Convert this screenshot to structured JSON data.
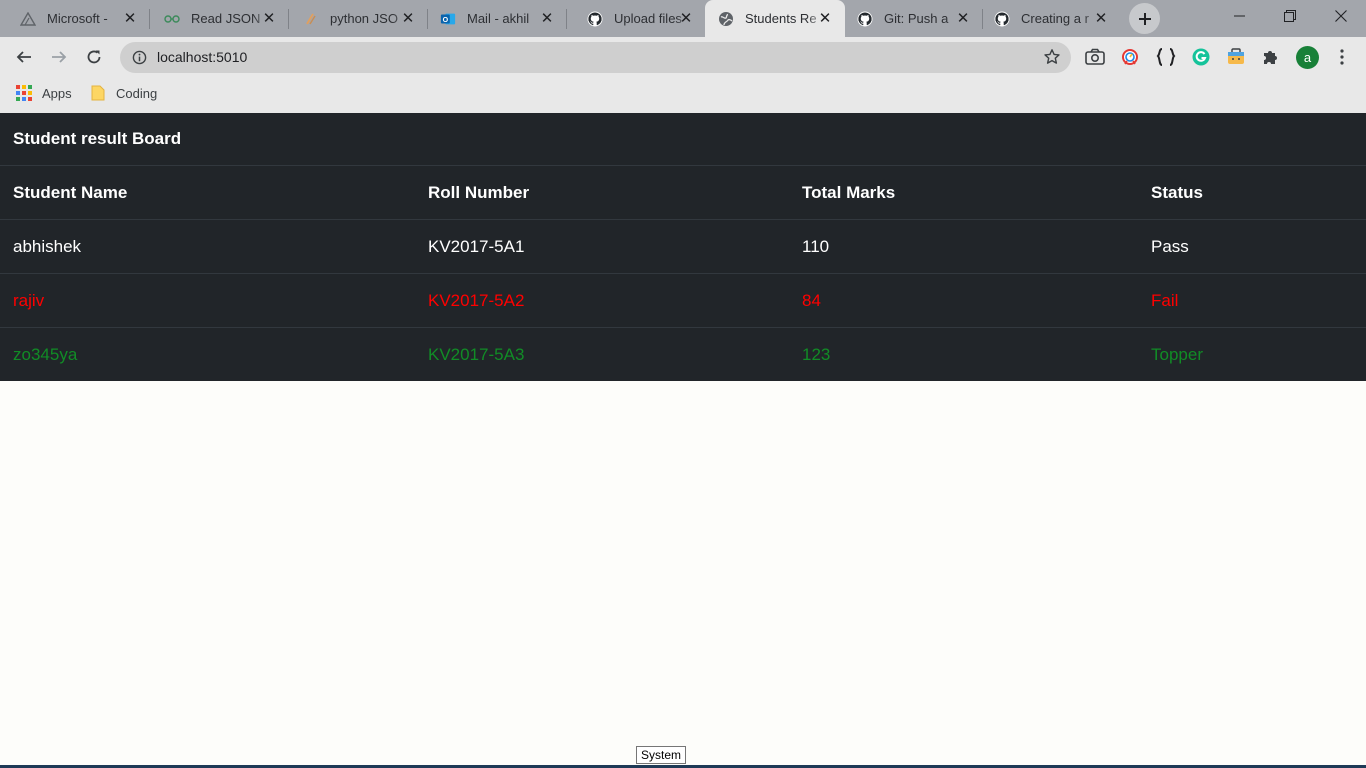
{
  "browser": {
    "tabs": [
      {
        "title": "Microsoft -",
        "icon": "triangle-icon"
      },
      {
        "title": "Read JSON",
        "icon": "eyeglasses-icon"
      },
      {
        "title": "python JSO",
        "icon": "python-icon"
      },
      {
        "title": "Mail - akhil",
        "icon": "outlook-icon"
      },
      {
        "title": "Upload files",
        "icon": "github-icon"
      },
      {
        "title": "Students Re",
        "icon": "globe-icon"
      },
      {
        "title": "Git: Push a",
        "icon": "github-icon"
      },
      {
        "title": "Creating a r",
        "icon": "github-icon"
      }
    ],
    "active_tab": 5,
    "url": "localhost:5010",
    "profile_initial": "a",
    "bookmarks": [
      {
        "label": "Apps",
        "icon": "apps-grid-icon"
      },
      {
        "label": "Coding",
        "icon": "folder-icon"
      }
    ]
  },
  "page": {
    "title": "Student result Board",
    "columns": [
      "Student Name",
      "Roll Number",
      "Total Marks",
      "Status"
    ],
    "rows": [
      {
        "name": "abhishek",
        "roll": "KV2017-5A1",
        "marks": "110",
        "status": "Pass",
        "color": "#ffffff"
      },
      {
        "name": "rajiv",
        "roll": "KV2017-5A2",
        "marks": "84",
        "status": "Fail",
        "color": "#ff0000"
      },
      {
        "name": "zo345ya",
        "roll": "KV2017-5A3",
        "marks": "123",
        "status": "Topper",
        "color": "#118c26"
      }
    ]
  },
  "tooltip": "System",
  "colors": {
    "table_bg": "#212529",
    "tab_strip": "#a3a6ac",
    "pass": "#ffffff",
    "fail": "#ff0000",
    "topper": "#118c26"
  }
}
